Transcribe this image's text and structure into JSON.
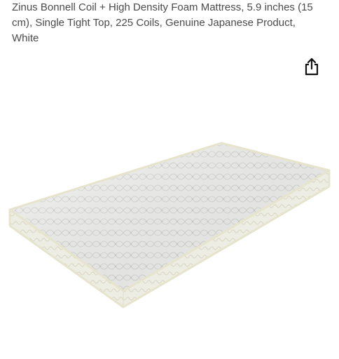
{
  "product": {
    "title": "Zinus Bonnell Coil + High Density Foam Mattress, 5.9 inches (15 cm), Single Tight Top, 225 Coils, Genuine Japanese Product, White"
  },
  "actions": {
    "share_icon": "share-icon"
  },
  "colors": {
    "text": "#4a4a4a",
    "mattress_top": "#f4f4f2",
    "mattress_side": "#ecebdf",
    "piping": "#e2e0c8"
  }
}
